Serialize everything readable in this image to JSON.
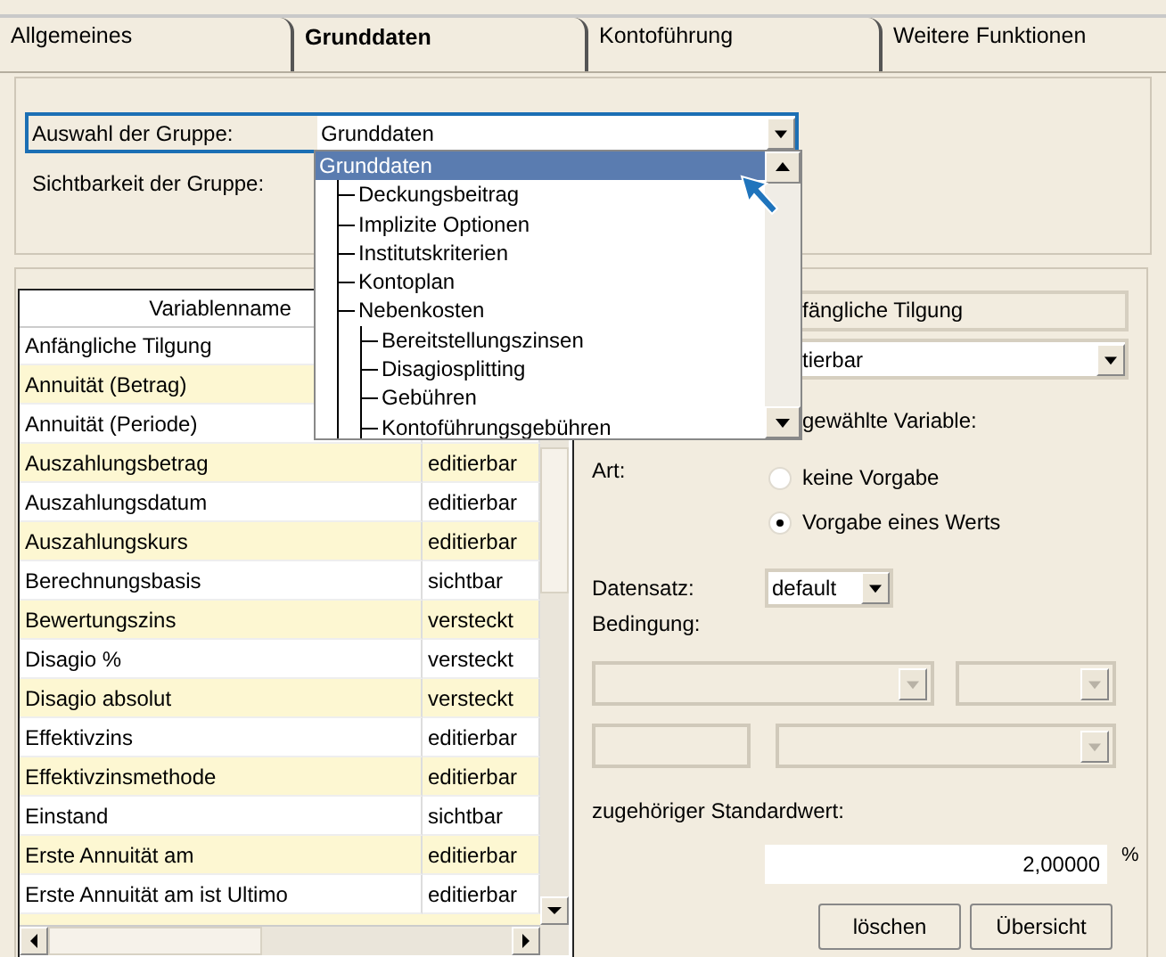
{
  "tabs": [
    {
      "label": "Allgemeines",
      "selected": false
    },
    {
      "label": "Grunddaten",
      "selected": true
    },
    {
      "label": "Kontoführung",
      "selected": false
    },
    {
      "label": "Weitere Funktionen",
      "selected": false
    }
  ],
  "group_select": {
    "label": "Auswahl der Gruppe:",
    "value": "Grunddaten",
    "focused": true
  },
  "visibility_label": "Sichtbarkeit der Gruppe:",
  "group_list": {
    "items": [
      {
        "label": "Grunddaten",
        "selected": true,
        "children": [
          {
            "label": "Deckungsbeitrag",
            "selected": false
          },
          {
            "label": "Implizite Optionen",
            "selected": false
          },
          {
            "label": "Institutskriterien",
            "selected": false
          },
          {
            "label": "Kontoplan",
            "selected": false
          },
          {
            "label": "Nebenkosten",
            "selected": false,
            "children": [
              {
                "label": "Bereitstellungszinsen",
                "selected": false
              },
              {
                "label": "Disagiosplitting",
                "selected": false
              },
              {
                "label": "Gebühren",
                "selected": false
              },
              {
                "label": "Kontoführungsgebühren",
                "selected": false
              }
            ]
          }
        ]
      }
    ]
  },
  "table": {
    "columns": [
      "Variablenname"
    ],
    "rows": [
      {
        "name": "Anfängliche Tilgung"
      },
      {
        "name": "Annuität (Betrag)"
      },
      {
        "name": "Annuität (Periode)"
      },
      {
        "name": "Auszahlungsbetrag",
        "column_2": "editierbar"
      },
      {
        "name": "Auszahlungsdatum",
        "column_2": "editierbar"
      },
      {
        "name": "Auszahlungskurs",
        "column_2": "editierbar"
      },
      {
        "name": "Berechnungsbasis",
        "column_2": "sichtbar"
      },
      {
        "name": "Bewertungszins",
        "column_2": "versteckt"
      },
      {
        "name": "Disagio %",
        "column_2": "versteckt"
      },
      {
        "name": "Disagio absolut",
        "column_2": "versteckt"
      },
      {
        "name": "Effektivzins",
        "column_2": "editierbar"
      },
      {
        "name": "Effektivzinsmethode",
        "column_2": "editierbar"
      },
      {
        "name": "Einstand",
        "column_2": "sichtbar"
      },
      {
        "name": "Erste Annuität am",
        "column_2": "editierbar"
      },
      {
        "name": "Erste Annuität am ist Ultimo",
        "column_2": "editierbar"
      }
    ]
  },
  "detail": {
    "variable_name": "fängliche Tilgung",
    "visibility": "tierbar",
    "section_label": "gewählte Variable:",
    "art_label": "Art:",
    "options": [
      {
        "label": "keine Vorgabe",
        "selected": false
      },
      {
        "label": "Vorgabe eines Werts",
        "selected": true
      }
    ],
    "dataset_label": "Datensatz:",
    "dataset": "default",
    "condition_label": "Bedingung:",
    "default_label": "zugehöriger Standardwert:",
    "default_value": "2,00000",
    "unit": "%",
    "buttons": [
      "löschen",
      "Übersicht"
    ]
  }
}
